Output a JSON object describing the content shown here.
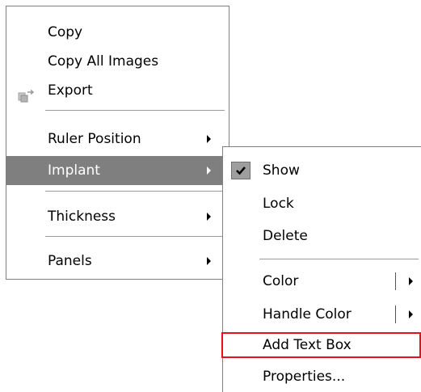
{
  "context_menu": {
    "items": [
      {
        "label": "Copy"
      },
      {
        "label": "Copy All Images"
      },
      {
        "label": "Export",
        "icon": "export-icon"
      },
      {
        "label": "Ruler Position",
        "has_submenu": true
      },
      {
        "label": "Implant",
        "has_submenu": true,
        "highlighted": true
      },
      {
        "label": "Thickness",
        "has_submenu": true
      },
      {
        "label": "Panels",
        "has_submenu": true
      }
    ]
  },
  "implant_submenu": {
    "items": [
      {
        "label": "Show",
        "checked": true
      },
      {
        "label": "Lock"
      },
      {
        "label": "Delete"
      },
      {
        "label": "Color",
        "has_submenu": true
      },
      {
        "label": "Handle Color",
        "has_submenu": true
      },
      {
        "label": "Add Text Box",
        "outlined": true
      },
      {
        "label": "Properties..."
      }
    ]
  },
  "colors": {
    "highlight_background": "#7f7f7f",
    "outline_red": "#e8101a"
  }
}
